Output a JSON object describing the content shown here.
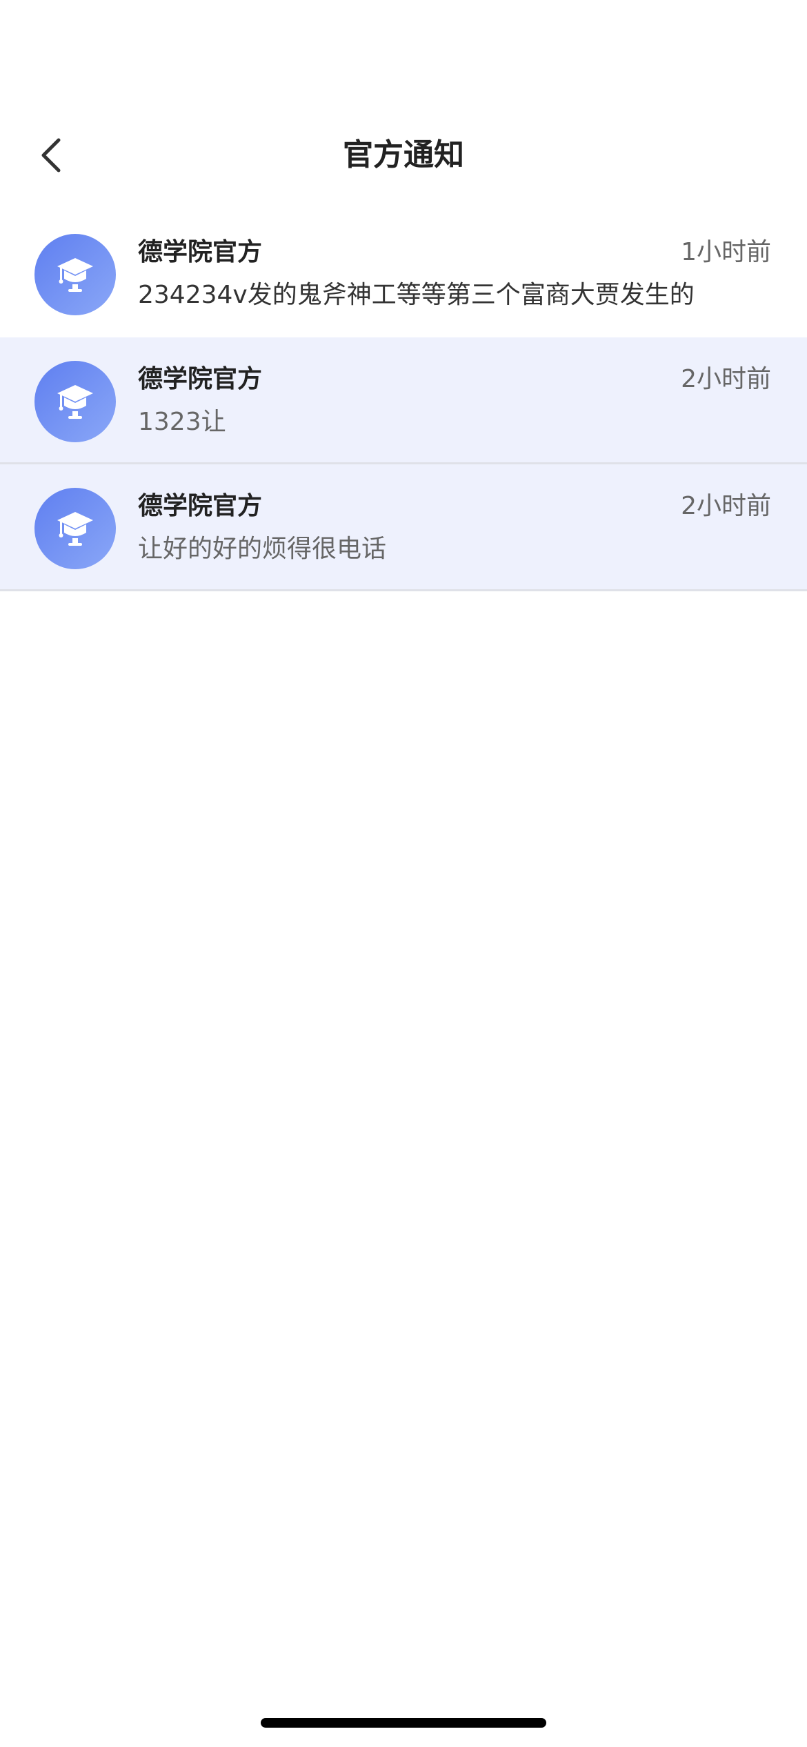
{
  "header": {
    "title": "官方通知",
    "back_icon": "chevron-left-icon"
  },
  "notifications": [
    {
      "sender": "德学院官方",
      "time": "1小时前",
      "preview": "234234v发的鬼斧神工等等第三个富商大贾发生的",
      "read": true
    },
    {
      "sender": "德学院官方",
      "time": "2小时前",
      "preview": "1323让",
      "read": false
    },
    {
      "sender": "德学院官方",
      "time": "2小时前",
      "preview": "让好的好的烦得很电话",
      "read": false
    }
  ],
  "colors": {
    "avatar_gradient_start": "#5f7ff0",
    "avatar_gradient_end": "#8aa7f7",
    "unread_background": "#eef1fd"
  }
}
